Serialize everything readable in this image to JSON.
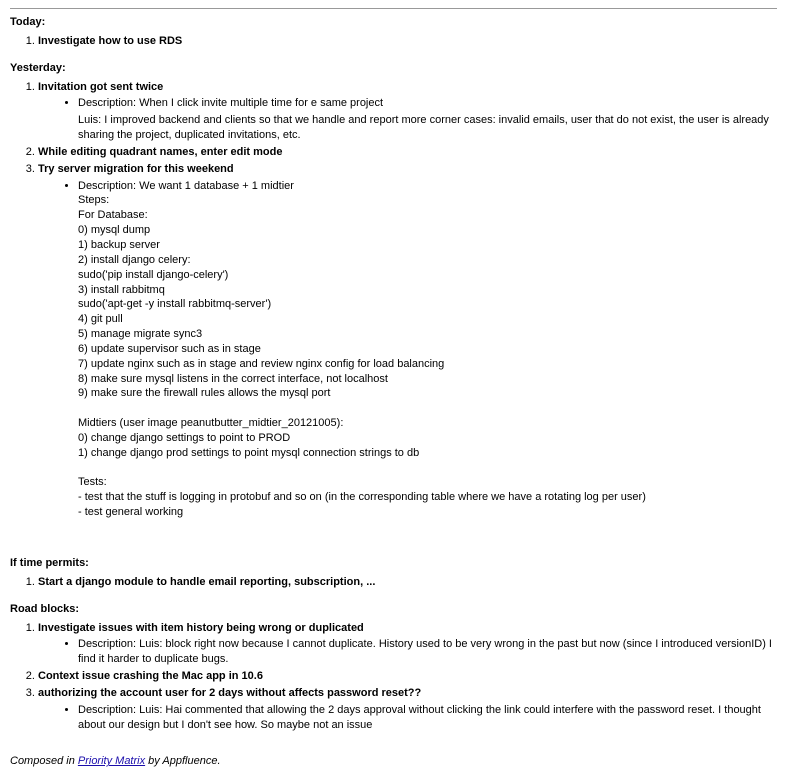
{
  "sections": {
    "today": {
      "title": "Today:",
      "items": [
        {
          "title": "Investigate how to use RDS"
        }
      ]
    },
    "yesterday": {
      "title": "Yesterday:",
      "items": [
        {
          "title": "Invitation got sent twice",
          "bullet": "Description: When I click invite multiple time for e same project",
          "indent_note": "Luis: I improved backend and clients so that we handle and report more corner cases: invalid emails, user that do not exist, the user is already sharing the project, duplicated invitations, etc."
        },
        {
          "title": "While editing quadrant names, enter edit mode"
        },
        {
          "title": "Try server migration for this weekend",
          "bullet": "Description: We want 1 database + 1 midtier\nSteps:\nFor Database:\n0) mysql dump\n1) backup server\n2) install django celery:\nsudo('pip install django-celery')\n3) install rabbitmq\nsudo('apt-get -y install rabbitmq-server')\n4) git pull\n5) manage migrate sync3\n6) update supervisor such as in stage\n7) update nginx such as in stage and review nginx config for load balancing\n8) make sure mysql listens in the correct interface, not localhost\n9) make sure the firewall rules allows the mysql port\n\nMidtiers (user image peanutbutter_midtier_20121005):\n0) change django settings to point to PROD\n1) change django prod settings to point mysql connection strings to db\n\nTests:\n- test that the stuff is logging in protobuf and so on (in the corresponding table where we have a rotating log per user)\n- test general working"
        }
      ]
    },
    "if_time": {
      "title": "If time permits:",
      "items": [
        {
          "title": "Start a django module to handle email reporting, subscription, ..."
        }
      ]
    },
    "roadblocks": {
      "title": "Road blocks:",
      "items": [
        {
          "title": "Investigate issues with item history being wrong or duplicated",
          "bullet": "Description: Luis: block right now because I cannot duplicate. History used to be very wrong in the past but now (since I introduced versionID) I find it harder to duplicate bugs."
        },
        {
          "title": "Context issue crashing the Mac app in 10.6"
        },
        {
          "title": "authorizing the account user for 2 days without affects password reset??",
          "bullet": "Description: Luis: Hai commented that allowing the 2 days approval without clicking the link could interfere with the password reset. I thought about our design but I don't see how. So maybe not an issue"
        }
      ]
    }
  },
  "footer": {
    "prefix": "Composed in ",
    "link_text": "Priority Matrix",
    "suffix": " by Appfluence."
  }
}
